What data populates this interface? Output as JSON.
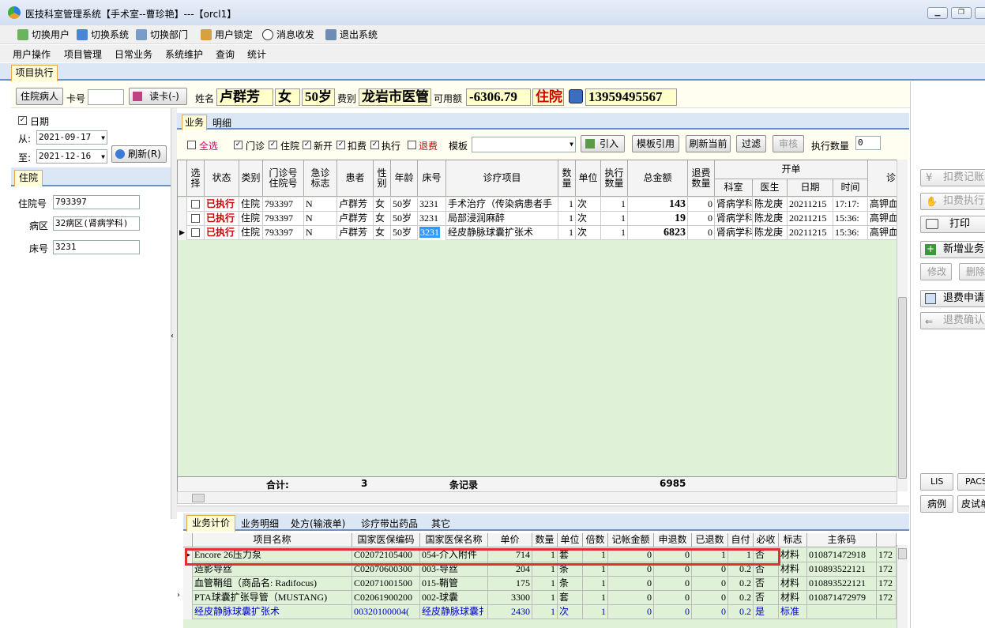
{
  "window": {
    "title": "医技科室管理系统【手术室--曹珍艳】---【orcl1】"
  },
  "toolbar": [
    {
      "label": "切换用户"
    },
    {
      "label": "切换系统"
    },
    {
      "label": "切换部门"
    },
    {
      "label": "用户锁定"
    },
    {
      "label": "消息收发"
    },
    {
      "label": "退出系统"
    }
  ],
  "menu": [
    "用户操作",
    "项目管理",
    "日常业务",
    "系统维护",
    "查询",
    "统计"
  ],
  "tab_exec": "项目执行",
  "patient": {
    "btn_inpatient": "住院病人",
    "card_label": "卡号",
    "card_value": "",
    "btn_read": "读卡(-)",
    "name_label": "姓名",
    "name": "卢群芳",
    "sex": "女",
    "age": "50岁",
    "fee_label": "费别",
    "fee": "龙岩市医管",
    "avail_label": "可用额",
    "avail": "-6306.79",
    "status": "住院",
    "phone": "13959495567"
  },
  "left": {
    "date_label": "日期",
    "from_label": "从:",
    "from": "2021-09-17",
    "to_label": "至:",
    "to": "2021-12-16",
    "refresh": "刷新(R)",
    "section": "住院",
    "hosp_no_label": "住院号",
    "hosp_no": "793397",
    "ward_label": "病区",
    "ward": "32病区(肾病学科)",
    "bed_label": "床号",
    "bed": "3231"
  },
  "subtabs": {
    "business": "业务",
    "detail": "明细"
  },
  "filters": {
    "select_all": "全选",
    "outpatient": "门诊",
    "inpatient": "住院",
    "new": "新开",
    "charge": "扣费",
    "executed": "执行",
    "refund": "退费",
    "template_label": "模板",
    "import": "引入",
    "template_ref": "模板引用",
    "refresh_current": "刷新当前",
    "filter": "过滤",
    "audit": "审核",
    "exec_qty_label": "执行数量",
    "exec_qty": "0"
  },
  "grid": {
    "headers": {
      "select": "选择",
      "status": "状态",
      "type": "类别",
      "clinic_no": "门诊号 住院号",
      "urgent": "急诊 标志",
      "patient": "患者",
      "sex": "性别",
      "age": "年龄",
      "bed": "床号",
      "item": "诊疗项目",
      "qty": "数量",
      "unit": "单位",
      "exec_qty": "执行 数量",
      "total": "总金额",
      "refund_qty": "退费 数量",
      "order": "开单",
      "dept": "科室",
      "doctor": "医生",
      "date": "日期",
      "time": "时间",
      "diag": "诊"
    },
    "rows": [
      {
        "status": "已执行",
        "type": "住院",
        "clinic_no": "793397",
        "urgent": "N",
        "patient": "卢群芳",
        "sex": "女",
        "age": "50岁",
        "bed": "3231",
        "item": "手术治疗（传染病患者手",
        "qty": "1",
        "unit": "次",
        "exec_qty": "1",
        "total": "143",
        "refund_qty": "0",
        "dept": "肾病学科",
        "doctor": "陈龙庚",
        "date": "20211215",
        "time": "17:17:",
        "diag": "高钾血"
      },
      {
        "status": "已执行",
        "type": "住院",
        "clinic_no": "793397",
        "urgent": "N",
        "patient": "卢群芳",
        "sex": "女",
        "age": "50岁",
        "bed": "3231",
        "item": "局部浸润麻醉",
        "qty": "1",
        "unit": "次",
        "exec_qty": "1",
        "total": "19",
        "refund_qty": "0",
        "dept": "肾病学科",
        "doctor": "陈龙庚",
        "date": "20211215",
        "time": "15:36:",
        "diag": "高钾血"
      },
      {
        "status": "已执行",
        "type": "住院",
        "clinic_no": "793397",
        "urgent": "N",
        "patient": "卢群芳",
        "sex": "女",
        "age": "50岁",
        "bed": "3231",
        "item": "经皮静脉球囊扩张术",
        "qty": "1",
        "unit": "次",
        "exec_qty": "1",
        "total": "6823",
        "refund_qty": "0",
        "dept": "肾病学科",
        "doctor": "陈龙庚",
        "date": "20211215",
        "time": "15:36:",
        "diag": "高钾血"
      }
    ],
    "footer": {
      "sum_label": "合计:",
      "count": "3",
      "records_label": "条记录",
      "total": "6985"
    }
  },
  "bottom_tabs": [
    "业务计价",
    "业务明细",
    "处方(输液单)",
    "诊疗带出药品",
    "其它"
  ],
  "bottom_grid": {
    "headers": [
      "项目名称",
      "国家医保编码",
      "国家医保名称",
      "单价",
      "数量",
      "单位",
      "倍数",
      "记帐金额",
      "申退数",
      "已退数",
      "自付",
      "必收",
      "标志",
      "主条码"
    ],
    "rows": [
      {
        "name": "Encore 26压力泵",
        "code": "C02072105400",
        "nname": "054-介入附件",
        "price": "714",
        "qty": "1",
        "unit": "套",
        "mult": "1",
        "amount": "0",
        "req": "0",
        "ret": "1",
        "self": "1",
        "must": "否",
        "flag": "材料",
        "barcode": "010871472918",
        "extra": "172"
      },
      {
        "name": "造影导丝",
        "code": "C02070600300",
        "nname": "003-导丝",
        "price": "204",
        "qty": "1",
        "unit": "条",
        "mult": "1",
        "amount": "0",
        "req": "0",
        "ret": "0",
        "self": "0.2",
        "must": "否",
        "flag": "材料",
        "barcode": "010893522121",
        "extra": "172"
      },
      {
        "name": "血管鞘组（商品名: Radifocus)",
        "code": "C02071001500",
        "nname": "015-鞘管",
        "price": "175",
        "qty": "1",
        "unit": "条",
        "mult": "1",
        "amount": "0",
        "req": "0",
        "ret": "0",
        "self": "0.2",
        "must": "否",
        "flag": "材料",
        "barcode": "010893522121",
        "extra": "172"
      },
      {
        "name": "PTA球囊扩张导管（MUSTANG)",
        "code": "C02061900200",
        "nname": "002-球囊",
        "price": "3300",
        "qty": "1",
        "unit": "套",
        "mult": "1",
        "amount": "0",
        "req": "0",
        "ret": "0",
        "self": "0.2",
        "must": "否",
        "flag": "材料",
        "barcode": "010871472979",
        "extra": "172"
      },
      {
        "name": "经皮静脉球囊扩张术",
        "code": "00320100004(",
        "nname": "经皮静脉球囊扌",
        "price": "2430",
        "qty": "1",
        "unit": "次",
        "mult": "1",
        "amount": "0",
        "req": "0",
        "ret": "0",
        "self": "0.2",
        "must": "是",
        "flag": "标准",
        "barcode": "",
        "extra": ""
      }
    ]
  },
  "right_buttons": {
    "charge_record": "扣费记账",
    "charge_exec": "扣费执行",
    "print": "打印",
    "add_business": "新增业务",
    "modify": "修改",
    "delete": "删除",
    "refund_apply": "退费申请",
    "refund_confirm": "退费确认",
    "lis": "LIS",
    "pacs": "PACS",
    "case": "病例",
    "skin_test": "皮试单"
  },
  "colors": {
    "accent": "#e8a847",
    "grid_bg": "#dff2d8",
    "highlight": "#e03030",
    "status_red": "#d00000",
    "link_blue": "#0000cc"
  }
}
